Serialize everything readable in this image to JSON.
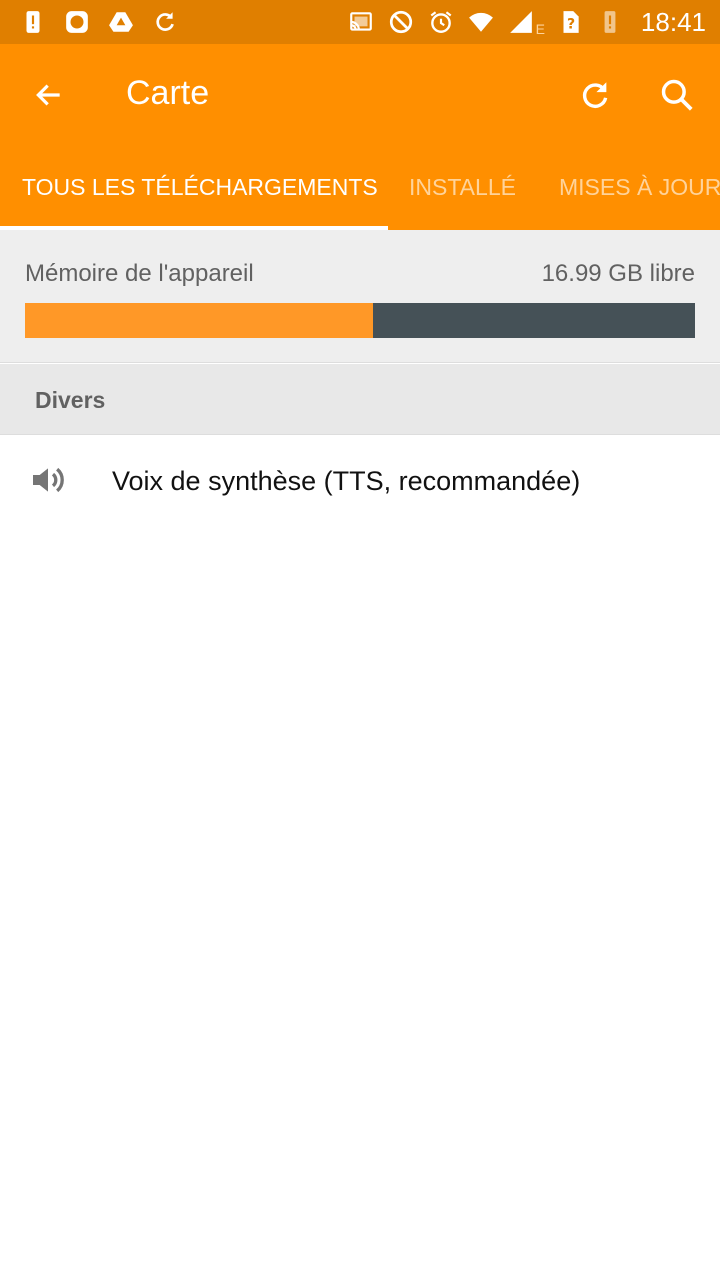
{
  "status_bar": {
    "time": "18:41",
    "network_type": "E",
    "left_icons": [
      "alert-battery-icon",
      "stop-circle-icon",
      "drive-icon",
      "sync-icon"
    ],
    "right_icons": [
      "cast-icon",
      "do-not-disturb-icon",
      "alarm-icon",
      "wifi-icon",
      "signal-icon",
      "sim-unknown-icon",
      "battery-alert-icon"
    ]
  },
  "app_bar": {
    "title": "Carte",
    "color": "#ff8f00"
  },
  "tabs": [
    {
      "label": "TOUS LES TÉLÉCHARGEMENTS",
      "active": true
    },
    {
      "label": "INSTALLÉ",
      "active": false
    },
    {
      "label": "MISES À JOUR",
      "active": false
    }
  ],
  "storage": {
    "label": "Mémoire de l'appareil",
    "free_text": "16.99 GB libre",
    "used_fraction": 0.52,
    "used_color": "#ff9827",
    "free_color": "#455157"
  },
  "section": {
    "label": "Divers"
  },
  "items": [
    {
      "label": "Voix de synthèse (TTS, recommandée)",
      "icon": "volume-icon"
    }
  ]
}
